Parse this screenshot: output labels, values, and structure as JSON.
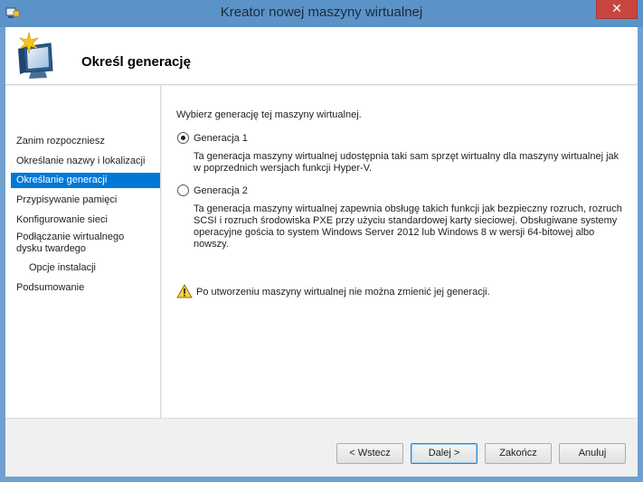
{
  "window": {
    "title": "Kreator nowej maszyny wirtualnej",
    "close_label": "✕"
  },
  "header": {
    "title": "Określ generację",
    "icon": "wizard-computer-icon"
  },
  "nav": {
    "items": [
      {
        "label": "Zanim rozpoczniesz",
        "selected": false
      },
      {
        "label": "Określanie nazwy i lokalizacji",
        "selected": false
      },
      {
        "label": "Określanie generacji",
        "selected": true
      },
      {
        "label": "Przypisywanie pamięci",
        "selected": false
      },
      {
        "label": "Konfigurowanie sieci",
        "selected": false
      },
      {
        "label": "Podłączanie wirtualnego dysku twardego",
        "selected": false
      },
      {
        "label": "Opcje instalacji",
        "selected": false
      },
      {
        "label": "Podsumowanie",
        "selected": false
      }
    ]
  },
  "main": {
    "instruction": "Wybierz generację tej maszyny wirtualnej.",
    "gen1": {
      "label": "Generacja 1",
      "checked": true,
      "description": "Ta generacja maszyny wirtualnej udostępnia taki sam sprzęt wirtualny dla maszyny wirtualnej jak w poprzednich wersjach funkcji Hyper-V."
    },
    "gen2": {
      "label": "Generacja 2",
      "checked": false,
      "description": "Ta generacja maszyny wirtualnej zapewnia obsługę takich funkcji jak bezpieczny rozruch, rozruch SCSI i rozruch środowiska PXE przy użyciu standardowej karty sieciowej. Obsługiwane systemy operacyjne gościa to system Windows Server 2012 lub Windows 8 w wersji 64-bitowej albo nowszy."
    },
    "warning": {
      "icon": "warning-icon",
      "text": "Po utworzeniu maszyny wirtualnej nie można zmienić jej generacji."
    }
  },
  "footer": {
    "back_label": "< Wstecz",
    "next_label": "Dalej >",
    "finish_label": "Zakończ",
    "cancel_label": "Anuluj"
  },
  "colors": {
    "titlebar": "#5b93c8",
    "selection": "#0078d7",
    "close": "#c7463f"
  }
}
